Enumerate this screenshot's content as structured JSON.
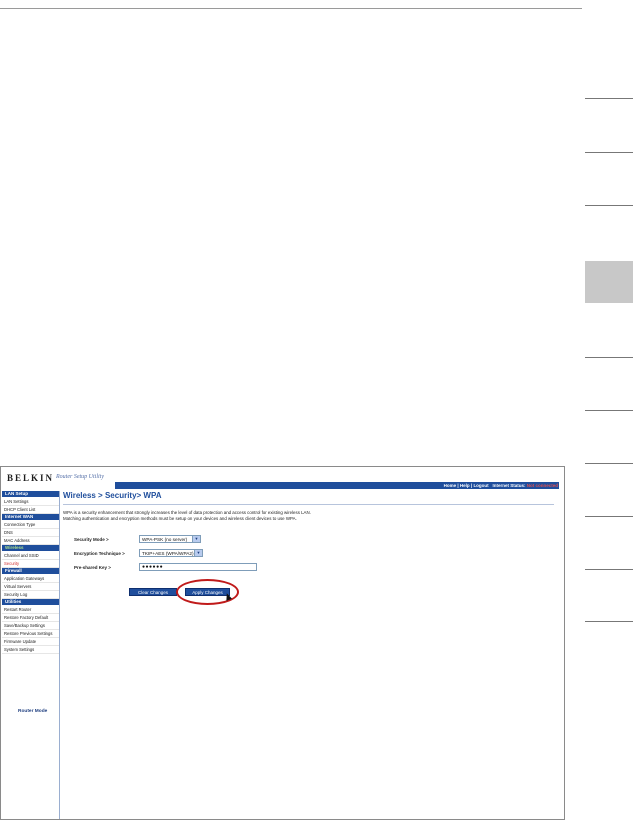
{
  "brand": {
    "name": "BELKIN",
    "tagline": "Router Setup Utility"
  },
  "topnav": {
    "home": "Home",
    "help": "Help",
    "logout": "Logout",
    "status_label": "Internet Status:",
    "status_value": "Not connected"
  },
  "sidebar": {
    "sections": [
      {
        "heading": "LAN Setup",
        "items": [
          "LAN Settings",
          "DHCP Client List"
        ]
      },
      {
        "heading": "Internet WAN",
        "items": [
          "Connection Type",
          "DNS",
          "MAC Address"
        ]
      },
      {
        "heading": "Wireless",
        "items": [
          "Channel and SSID",
          "Security"
        ]
      },
      {
        "heading": "Firewall",
        "items": [
          "Application Gateways",
          "Virtual Servers",
          "Security Log"
        ]
      },
      {
        "heading": "Utilities",
        "items": [
          "Restart Router",
          "Restore Factory Default",
          "Save/Backup Settings",
          "Restore Previous Settings",
          "Firmware Update",
          "System Settings"
        ]
      }
    ],
    "router_mode": "Router Mode"
  },
  "main": {
    "title": "Wireless > Security> WPA",
    "description": "WPA is a security enhancement that strongly increases the level of data protection and access control for existing wireless LAN. Matching authentication and encryption methods must be setup on your devices and wireless client devices to use WPA.",
    "security_mode_label": "Security Mode >",
    "security_mode_value": "WPA-PSK (no server)",
    "encryption_label": "Encryption Technique >",
    "encryption_value": "TKIP+AES (WPA/WPA2)",
    "psk_label": "Pre-shared Key >",
    "psk_value": "●●●●●●",
    "clear_button": "Clear Changes",
    "apply_button": "Apply Changes"
  },
  "colors": {
    "brand_blue": "#1f4e9c",
    "highlight": "#c01a1a"
  }
}
